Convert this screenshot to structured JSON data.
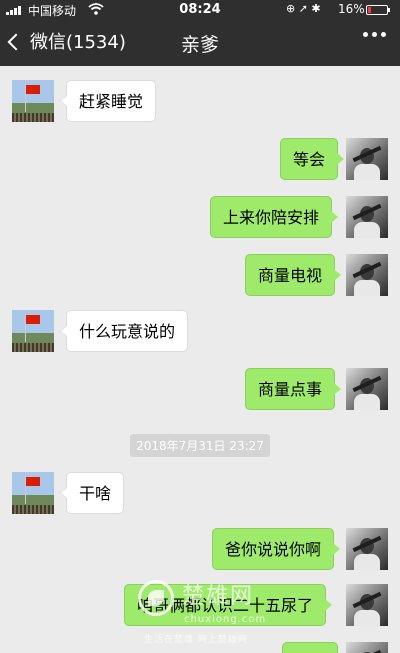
{
  "status_bar": {
    "carrier": "中国移动",
    "time": "08:24",
    "battery": "16%",
    "battery_level": 0.16
  },
  "nav": {
    "back_label": "微信(1534)",
    "title": "亲爹"
  },
  "messages": [
    {
      "from": "them",
      "text": "赶紧睡觉"
    },
    {
      "from": "me",
      "text": "等会"
    },
    {
      "from": "me",
      "text": "上来你陪安排"
    },
    {
      "from": "me",
      "text": "商量电视"
    },
    {
      "from": "them",
      "text": "什么玩意说的"
    },
    {
      "from": "me",
      "text": "商量点事"
    },
    {
      "from": "them",
      "text": "干啥"
    },
    {
      "from": "me",
      "text": "爸你说说你啊"
    },
    {
      "from": "me",
      "text": "咱哥俩都认识二十五尿了"
    }
  ],
  "timestamp": "2018年7月31日 23:27",
  "watermark": {
    "brand": "楚雄网",
    "url": "chuxiong.com",
    "slogan": "生活在楚雄 网上楚雄网"
  },
  "colors": {
    "bar_bg": "#2f2f2f",
    "chat_bg": "#ebebeb",
    "outgoing_bubble": "#9eea6a",
    "incoming_bubble": "#ffffff"
  }
}
